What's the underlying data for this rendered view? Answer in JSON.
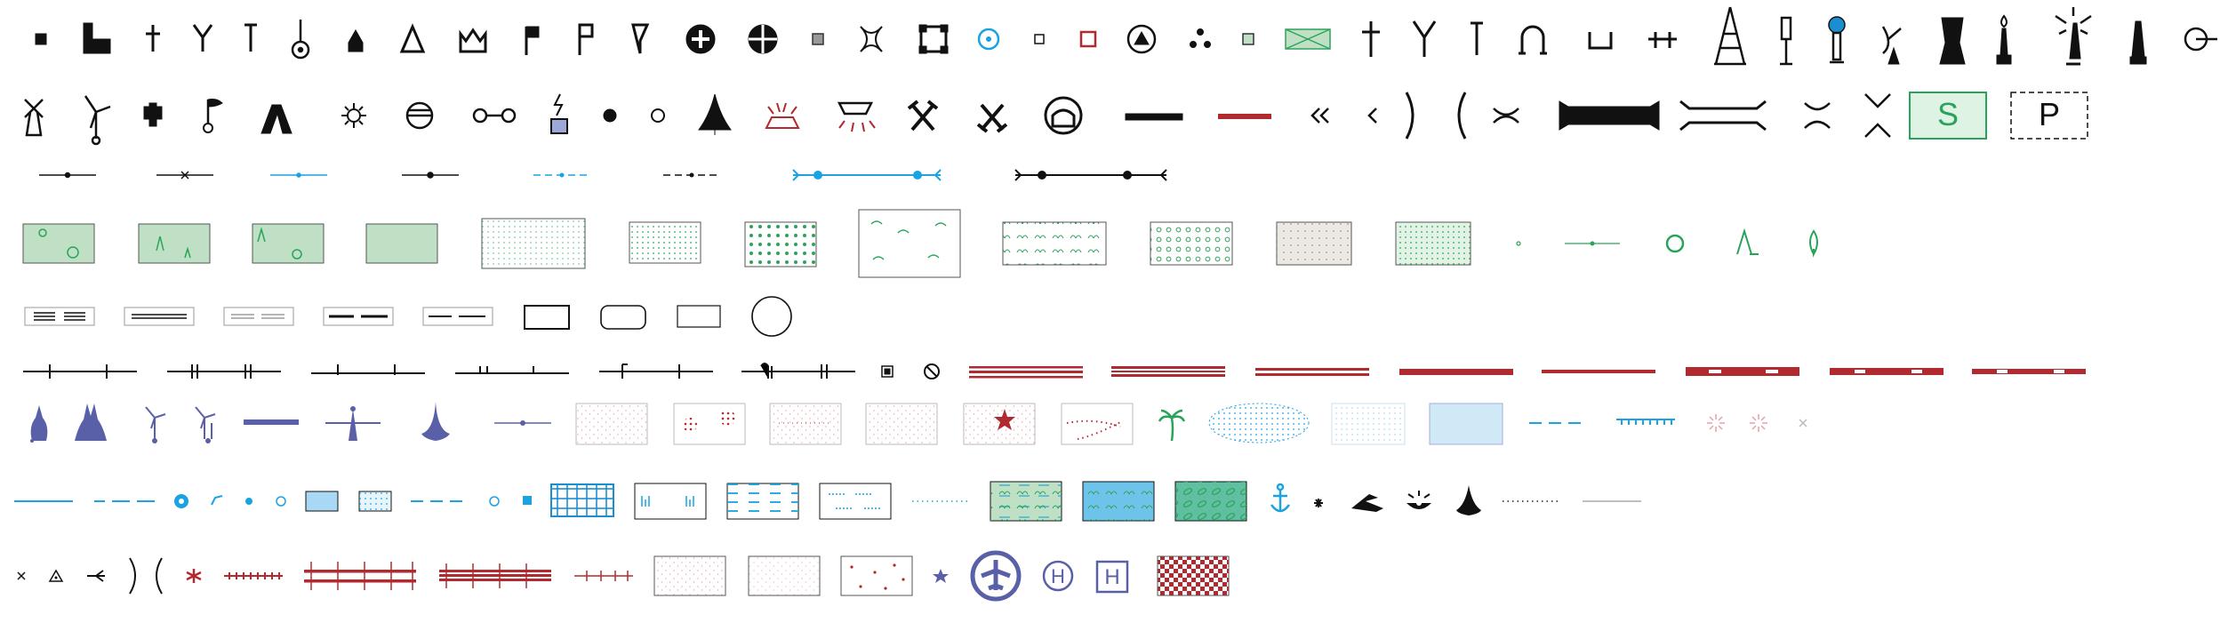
{
  "sheet_title": "",
  "colors": {
    "black": "#111111",
    "cyan": "#1aa3e0",
    "red": "#b02a30",
    "green_fill": "#bfe0c4",
    "green_stroke": "#2aa35a",
    "navy": "#5a60a8",
    "pink": "#e8a0a8",
    "light_blue": "#cfe9f7",
    "blue_grid": "#1a8fd0",
    "gray": "#888888"
  },
  "letters": {
    "s_symbol": "S",
    "p_symbol": "P",
    "h_circle": "H",
    "h_square": "H"
  },
  "rows": [
    {
      "name": "point-symbols-row-1",
      "count": 44
    },
    {
      "name": "point-symbols-row-2",
      "count": 30
    },
    {
      "name": "line-symbols-row-3",
      "count": 8
    },
    {
      "name": "vegetation-area-row-4",
      "count": 17
    },
    {
      "name": "road-outline-row-5",
      "count": 9
    },
    {
      "name": "railway-row-6",
      "count": 15
    },
    {
      "name": "terrain-row-7",
      "count": 21
    },
    {
      "name": "hydrography-row-8",
      "count": 25
    },
    {
      "name": "misc-row-9",
      "count": 17
    }
  ]
}
